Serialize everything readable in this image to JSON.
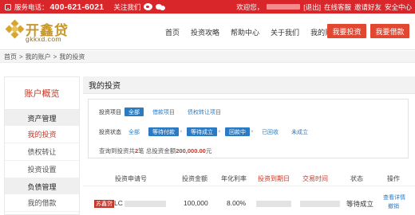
{
  "topbar": {
    "service_label": "服务电话：",
    "phone": "400-621-6021",
    "follow_label": "关注我们",
    "greeting": "欢迎您，",
    "logout": "[退出]",
    "online_service": "在线客服",
    "invite": "邀请好友",
    "security": "安全中心"
  },
  "logo": {
    "name": "开鑫贷",
    "domain": "gkkxd.com"
  },
  "nav": {
    "items": [
      "首页",
      "投资攻略",
      "帮助中心",
      "关于我们",
      "我的账户"
    ],
    "invest_button": "我要投资",
    "borrow_button": "我要借款"
  },
  "breadcrumb": {
    "items": [
      "首页",
      "我的账户",
      "我的投资"
    ],
    "separator": ">"
  },
  "sidebar": {
    "title": "账户概览",
    "asset_group": "资产管理",
    "asset_items": [
      "我的投资",
      "债权转让",
      "投资设置"
    ],
    "debt_group": "负债管理",
    "debt_items": [
      "我的借款"
    ]
  },
  "main": {
    "title": "我的投资",
    "filter": {
      "project_label": "投资项目",
      "project_options": [
        "全部",
        "借款项目",
        "债权转让项目"
      ],
      "status_label": "投资状态",
      "status_options": [
        "全部",
        "等待付款",
        "等待成立",
        "回款中",
        "已回收",
        "未成立"
      ]
    },
    "summary": {
      "prefix": "查询到投资共",
      "count": "2",
      "middle": "笔 总投资金额",
      "amount": "200,000.00",
      "suffix": "元"
    },
    "table": {
      "headers": [
        "投资申请号",
        "投资金额",
        "年化利率",
        "投资到期日",
        "交易时间",
        "状态",
        "操作"
      ],
      "row": {
        "badge": "苏鑫贷",
        "id_prefix": "LC",
        "amount": "100,000",
        "rate": "8.00%",
        "status": "等待成立",
        "action_detail": "查看详情",
        "action_cancel": "撤销"
      }
    }
  },
  "colors": {
    "brand_red": "#d9262a",
    "accent_blue": "#2a7bc3",
    "logo_gold": "#c9962a"
  }
}
